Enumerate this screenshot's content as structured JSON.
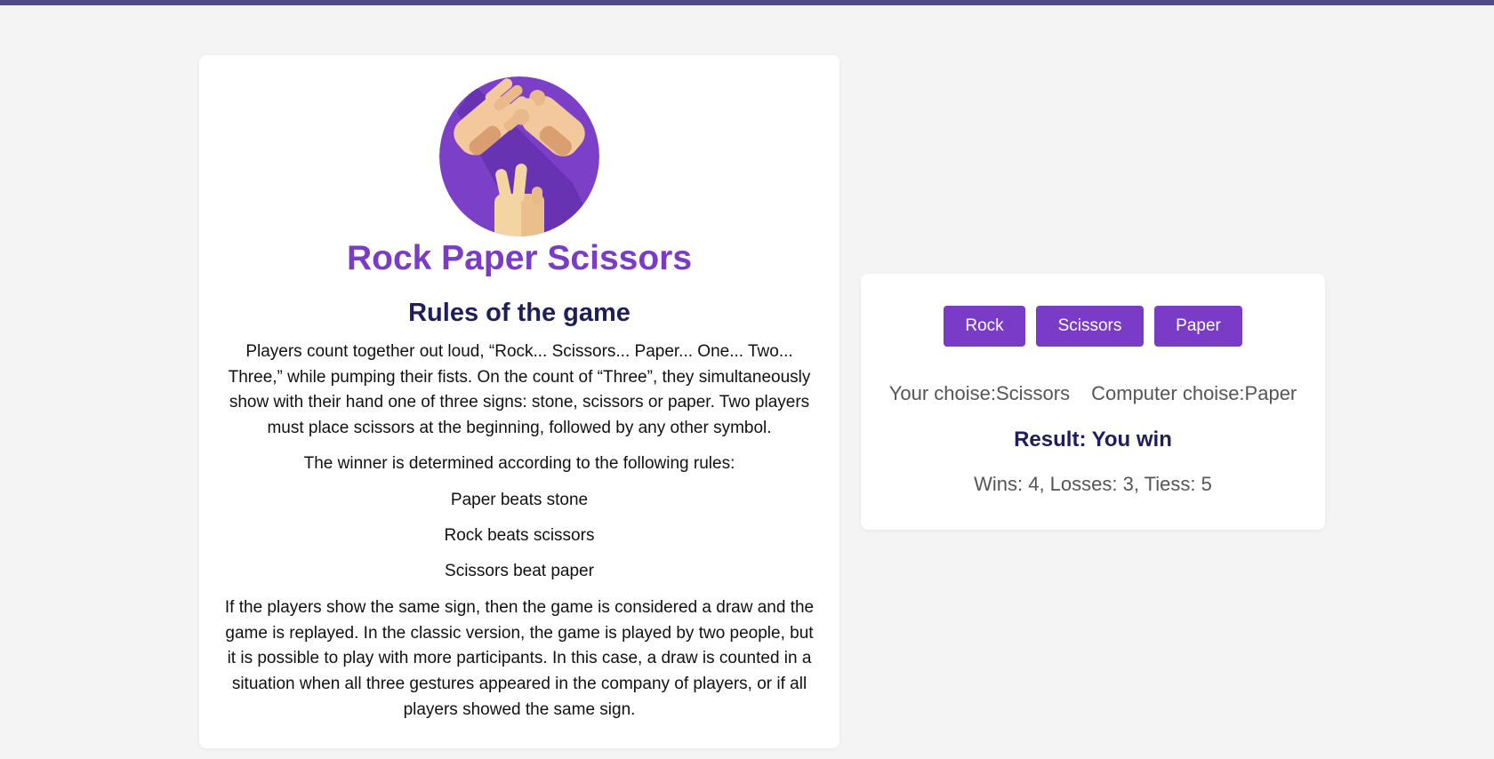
{
  "colors": {
    "accent": "#7a3cc6",
    "heading": "#1e1e5a",
    "top_bar": "#514a8a",
    "background": "#f4f4f4"
  },
  "rules_card": {
    "logo_icon": "rock-paper-scissors-hands-icon",
    "title": "Rock Paper Scissors",
    "heading": "Rules of the game",
    "paragraphs": [
      "Players count together out loud, “Rock... Scissors... Paper... One... Two... Three,” while pumping their fists. On the count of “Three”, they simultaneously show with their hand one of three signs: stone, scissors or paper. Two players must place scissors at the beginning, followed by any other symbol.",
      "The winner is determined according to the following rules:",
      "Paper beats stone",
      "Rock beats scissors",
      "Scissors beat paper",
      "If the players show the same sign, then the game is considered a draw and the game is replayed. In the classic version, the game is played by two people, but it is possible to play with more participants. In this case, a draw is counted in a situation when all three gestures appeared in the company of players, or if all players showed the same sign."
    ]
  },
  "game_card": {
    "buttons": {
      "rock": "Rock",
      "scissors": "Scissors",
      "paper": "Paper"
    },
    "your_choice_label": "Your choise:",
    "your_choice_value": "Scissors",
    "computer_choice_label": "Computer choise:",
    "computer_choice_value": "Paper",
    "result_label": "Result: ",
    "result_value": "You win",
    "score_text": "Wins: 4, Losses: 3, Tiess: 5"
  }
}
